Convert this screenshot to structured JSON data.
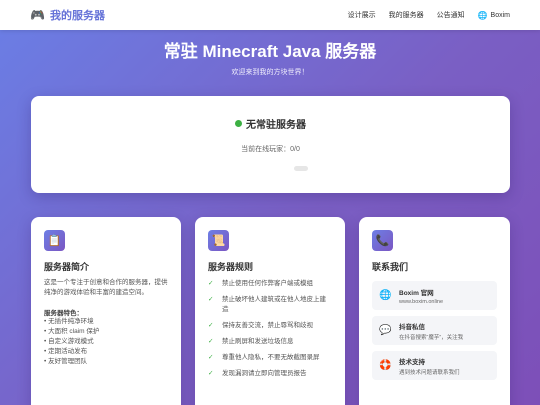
{
  "nav": {
    "brand_icon": "🎮",
    "brand": "我的服务器",
    "links": [
      "设计展示",
      "我的服务器",
      "公告通知"
    ],
    "lang_icon": "🌐",
    "lang": "Boxim"
  },
  "hero": {
    "title": "常驻 Minecraft Java 服务器",
    "subtitle": "欢迎来到我的方块世界！"
  },
  "status": {
    "text": "无常驻服务器",
    "online_label": "当前在线玩家：0/0",
    "dot_color": "#3cb043"
  },
  "intro": {
    "icon": "📋",
    "title": "服务器简介",
    "description": "这是一个专注于创意和合作的服务器，提供纯净的游戏体验和丰富的建造空间。",
    "features_title": "服务器特色：",
    "features": [
      "• 无插件纯净环境",
      "• 大面积 claim 保护",
      "• 自定义游戏模式",
      "• 定期活动发布",
      "• 友好管理团队"
    ]
  },
  "rules": {
    "icon": "📜",
    "title": "服务器规则",
    "check": "✓",
    "items": [
      "禁止使用任何作弊客户端或模组",
      "禁止破坏他人建筑或在他人地皮上建造",
      "保持友善交流，禁止辱骂和歧视",
      "禁止刷屏和发送垃圾信息",
      "尊重他人隐私，不要无故截图录屏",
      "发现漏洞请立即向管理员报告"
    ]
  },
  "contact": {
    "icon": "📞",
    "title": "联系我们",
    "items": [
      {
        "icon": "🌐",
        "name": "Boxim 官网",
        "detail": "www.boxim.online"
      },
      {
        "icon": "💬",
        "name": "抖音私信",
        "detail": "在抖音搜索“魔芋”，关注我"
      },
      {
        "icon": "🛟",
        "name": "技术支持",
        "detail": "遇到技术问题请联系我们"
      }
    ]
  },
  "colors": {
    "accent": "#6673d8",
    "gradient_start": "#6a7fe6",
    "gradient_end": "#7d4fb8"
  }
}
